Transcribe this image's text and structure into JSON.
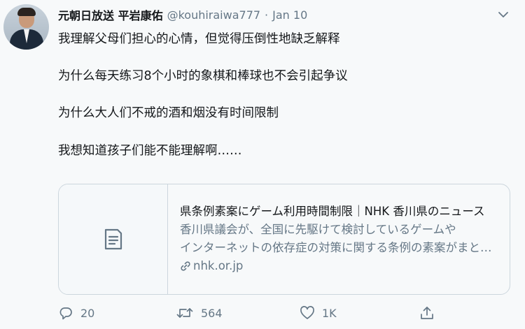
{
  "tweet": {
    "display_name": "元朝日放送 平岩康佑",
    "handle": "@kouhiraiwa777",
    "separator": "·",
    "date": "Jan 10",
    "lines": [
      "我理解父母们担心的心情，但觉得压倒性地缺乏解释",
      "为什么每天练习8个小时的象棋和棒球也不会引起争议",
      "为什么大人们不戒的酒和烟没有时间限制",
      "我想知道孩子们能不能理解啊……"
    ]
  },
  "card": {
    "title": "県条例素案にゲーム利用時間制限｜NHK 香川県のニュース",
    "description_line1": "香川県議会が、全国に先駆けて検討しているゲームや",
    "description_line2": "インターネットの依存症の対策に関する条例の素案がまとまりました",
    "domain": "nhk.or.jp"
  },
  "actions": {
    "reply_count": "20",
    "retweet_count": "564",
    "like_count": "1K",
    "share_count": ""
  },
  "colors": {
    "background": "#f7f9fa",
    "text_primary": "#14171a",
    "text_secondary": "#657786",
    "border": "#ccd6dd"
  }
}
